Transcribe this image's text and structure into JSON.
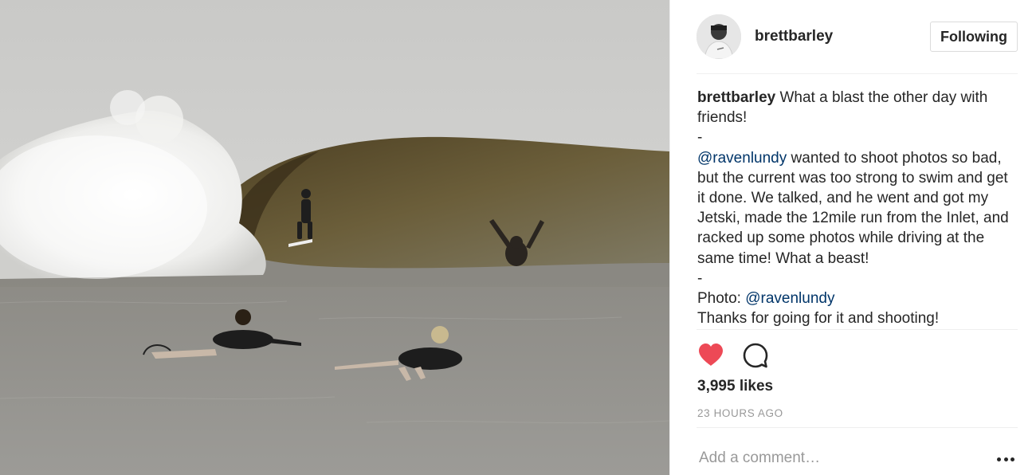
{
  "post": {
    "username": "brettbarley",
    "follow_label": "Following",
    "caption": {
      "author": "brettbarley",
      "line1": "What a blast the other day with friends!",
      "dash1": "-",
      "mention1": "@ravenlundy",
      "line2": "wanted to shoot photos so bad, but the current was too strong to swim and get it done. We talked, and he went and got my Jetski, made the 12mile run from the Inlet, and racked up some photos while driving at the same time! What a beast!",
      "dash2": "-",
      "photo_label": "Photo:",
      "mention2": "@ravenlundy",
      "line3": "Thanks for going for it and shooting!"
    },
    "likes": "3,995 likes",
    "time": "23 HOURS AGO",
    "comment_placeholder": "Add a comment…",
    "liked": true
  },
  "colors": {
    "heart": "#ed4956",
    "link": "#003569",
    "muted": "#999999",
    "text": "#262626",
    "divider": "#efefef"
  },
  "icons": {
    "like": "heart-icon",
    "comment": "comment-icon",
    "more": "more-options-icon"
  }
}
